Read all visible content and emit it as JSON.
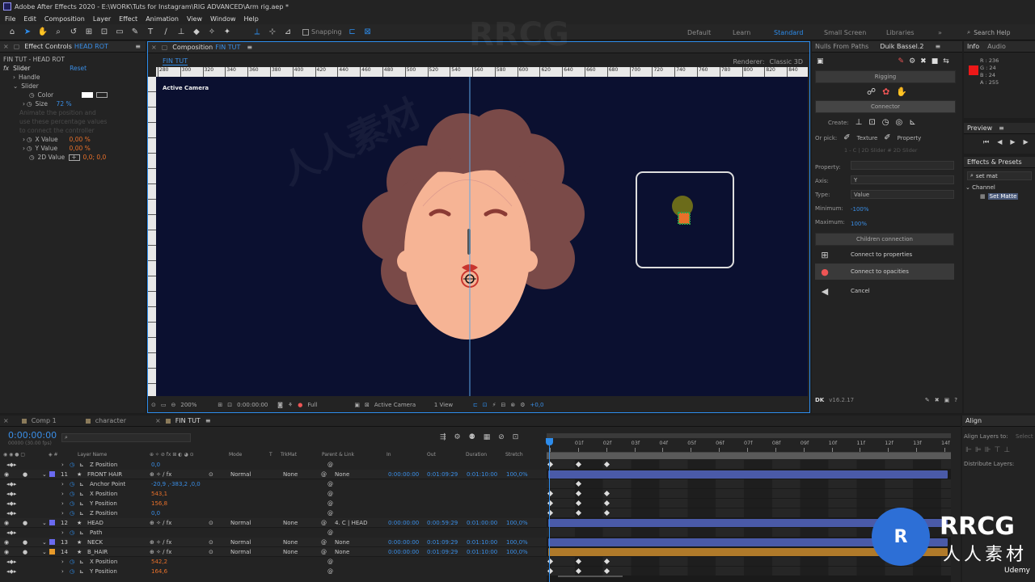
{
  "app": {
    "title": "Adobe After Effects 2020 - E:\\WORK\\Tuts for Instagram\\RIG ADVANCED\\Arm rig.aep *"
  },
  "menu": [
    "File",
    "Edit",
    "Composition",
    "Layer",
    "Effect",
    "Animation",
    "View",
    "Window",
    "Help"
  ],
  "toolbar": {
    "snapping": "Snapping"
  },
  "workspaces": [
    "Default",
    "Learn",
    "Standard",
    "Small Screen",
    "Libraries"
  ],
  "search_help": "Search Help",
  "effect_controls": {
    "tab": "Effect Controls",
    "tab_layer": "HEAD ROT",
    "subtitle": "FIN TUT - HEAD ROT",
    "slider_label": "Slider",
    "reset": "Reset",
    "handle": "Handle",
    "slider_group": "Slider",
    "color": "Color",
    "size": "Size",
    "size_value": "72 %",
    "note": [
      "Animate the position and",
      "use these percentage values",
      "to connect the controller"
    ],
    "x_value": "X Value",
    "x_val": "0,00 %",
    "y_value": "Y Value",
    "y_val": "0,00 %",
    "twod_value": "2D Value",
    "twod_val": "0,0; 0,0"
  },
  "composition": {
    "tab": "Composition",
    "tab_name": "FIN TUT",
    "subtab": "FIN TUT",
    "renderer_label": "Renderer:",
    "renderer": "Classic 3D",
    "active_camera": "Active Camera",
    "ruler": [
      "280",
      "300",
      "320",
      "340",
      "360",
      "380",
      "400",
      "420",
      "440",
      "460",
      "480",
      "500",
      "520",
      "540",
      "560",
      "580",
      "600",
      "620",
      "640",
      "660",
      "680",
      "700",
      "720",
      "740",
      "760",
      "780",
      "800",
      "820",
      "840"
    ]
  },
  "viewer_footer": {
    "zoom": "200%",
    "timecode": "0:00:00:00",
    "resolution": "Full",
    "camera": "Active Camera",
    "views": "1 View",
    "exposure": "+0,0"
  },
  "duik": {
    "tabs": [
      "Nulls From Paths",
      "Duik Bassel.2"
    ],
    "rigging": "Rigging",
    "connector": "Connector",
    "create": "Create:",
    "or_pick": "Or pick:",
    "texture": "Texture",
    "property": "Property",
    "hint": "1 - C | 2D Slider # 2D Slider",
    "property_label": "Property:",
    "axis_label": "Axis:",
    "axis_value": "Y",
    "type_label": "Type:",
    "type_value": "Value",
    "min_label": "Minimum:",
    "min_value": "-100%",
    "max_label": "Maximum:",
    "max_value": "100%",
    "children_connection": "Children connection",
    "connect_properties": "Connect to properties",
    "connect_opacities": "Connect to opacities",
    "cancel": "Cancel",
    "version": "v16.2.17"
  },
  "info": {
    "tab": "Info",
    "audio": "Audio",
    "r": "R : 236",
    "g": "G : 24",
    "b": "B : 24",
    "a": "A : 255"
  },
  "preview": {
    "tab": "Preview"
  },
  "effects_presets": {
    "tab": "Effects & Presets",
    "search": "set mat",
    "category": "Channel",
    "item": "Set Matte"
  },
  "align": {
    "tab": "Align",
    "align_to": "Align Layers to:",
    "selection": "Selection",
    "distribute": "Distribute Layers:"
  },
  "timeline": {
    "tabs": [
      "Comp 1",
      "character",
      "FIN TUT"
    ],
    "timecode": "0:00:00:00",
    "fps": "00000 (30.00 fps)",
    "columns": {
      "layer_name": "Layer Name",
      "mode": "Mode",
      "t": "T",
      "trkmat": "TrkMat",
      "parent": "Parent & Link",
      "in": "In",
      "out": "Out",
      "duration": "Duration",
      "stretch": "Stretch"
    },
    "ruler": [
      "0f",
      "01f",
      "02f",
      "03f",
      "04f",
      "05f",
      "06f",
      "07f",
      "08f",
      "09f",
      "10f",
      "11f",
      "12f",
      "13f",
      "14f"
    ],
    "rows": [
      {
        "kind": "prop",
        "indent": 2,
        "name": "Z Position",
        "value": "0,0"
      },
      {
        "kind": "layer",
        "num": "11",
        "name": "FRONT HAIR",
        "color": "#6a6af0",
        "mode": "Normal",
        "trkmat": "None",
        "parent": "None",
        "in": "0:00:00:00",
        "out": "0:01:09:29",
        "dur": "0:01:10:00",
        "stretch": "100,0%"
      },
      {
        "kind": "prop",
        "indent": 1,
        "name": "Anchor Point",
        "value": "-20,9 ,-383,2 ,0,0"
      },
      {
        "kind": "prop",
        "indent": 2,
        "name": "X Position",
        "value": "543,1",
        "vc": "orange"
      },
      {
        "kind": "prop",
        "indent": 2,
        "name": "Y Position",
        "value": "156,8",
        "vc": "orange"
      },
      {
        "kind": "prop",
        "indent": 2,
        "name": "Z Position",
        "value": "0,0"
      },
      {
        "kind": "layer",
        "num": "12",
        "name": "HEAD",
        "color": "#6a6af0",
        "mode": "Normal",
        "trkmat": "None",
        "parent": "4. C | HEAD",
        "in": "0:00:00:00",
        "out": "0:00:59:29",
        "dur": "0:01:00:00",
        "stretch": "100,0%"
      },
      {
        "kind": "prop",
        "indent": 2,
        "name": "Path",
        "value": ""
      },
      {
        "kind": "layer",
        "num": "13",
        "name": "NECK",
        "color": "#6a6af0",
        "mode": "Normal",
        "trkmat": "None",
        "parent": "None",
        "in": "0:00:00:00",
        "out": "0:01:09:29",
        "dur": "0:01:10:00",
        "stretch": "100,0%"
      },
      {
        "kind": "layer",
        "num": "14",
        "name": "B_HAIR",
        "color": "#e89a2a",
        "mode": "Normal",
        "trkmat": "None",
        "parent": "None",
        "in": "0:00:00:00",
        "out": "0:01:09:29",
        "dur": "0:01:10:00",
        "stretch": "100,0%"
      },
      {
        "kind": "prop",
        "indent": 2,
        "name": "X Position",
        "value": "542,2",
        "vc": "orange"
      },
      {
        "kind": "prop",
        "indent": 2,
        "name": "Y Position",
        "value": "164,6",
        "vc": "orange"
      }
    ]
  },
  "watermarks": [
    "RRCG",
    "人人素材",
    "Udemy"
  ],
  "colors": {
    "accent": "#2d8ceb",
    "comp_bg": "#0b1030",
    "hair": "#7a4a48",
    "face": "#f6b495",
    "info_swatch": "#ec1818"
  }
}
